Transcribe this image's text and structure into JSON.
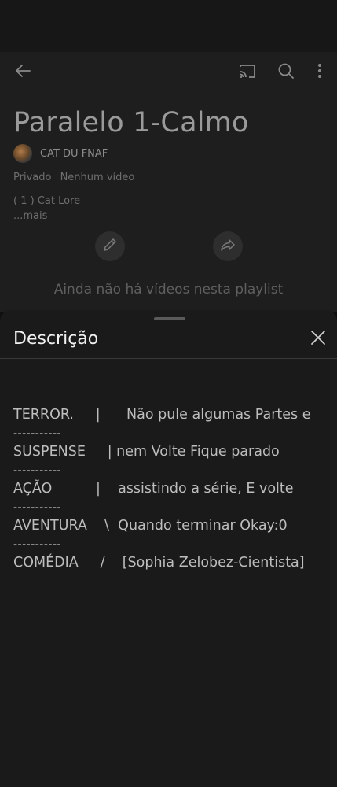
{
  "playlist": {
    "title": "Paralelo 1-Calmo",
    "channel_name": "CAT DU FNAF",
    "visibility": "Privado",
    "video_count": "Nenhum vídeo",
    "description_preview": "( 1 ) Cat Lore",
    "more_label": "...mais",
    "empty_message": "Ainda não há vídeos nesta playlist"
  },
  "topbar": {
    "icons": [
      "back-arrow-icon",
      "cast-icon",
      "search-icon",
      "more-vert-icon"
    ]
  },
  "actions": {
    "icons": [
      "pencil-icon",
      "share-icon"
    ]
  },
  "sheet": {
    "title": "Descrição",
    "lines": [
      "TERROR.     |      Não pule algumas Partes e",
      "-----------",
      "SUSPENSE     | nem Volte Fique parado",
      "-----------",
      "AÇÃO          |    assistindo a série, E volte",
      "-----------",
      "AVENTURA    \\  Quando terminar Okay:0",
      "-----------",
      "COMÉDIA     /    [Sophia Zelobez-Cientista]"
    ]
  },
  "colors": {
    "background": "#0f0f0f",
    "page_overlay": "#1e1e1e",
    "sheet": "#1a1a1a"
  }
}
